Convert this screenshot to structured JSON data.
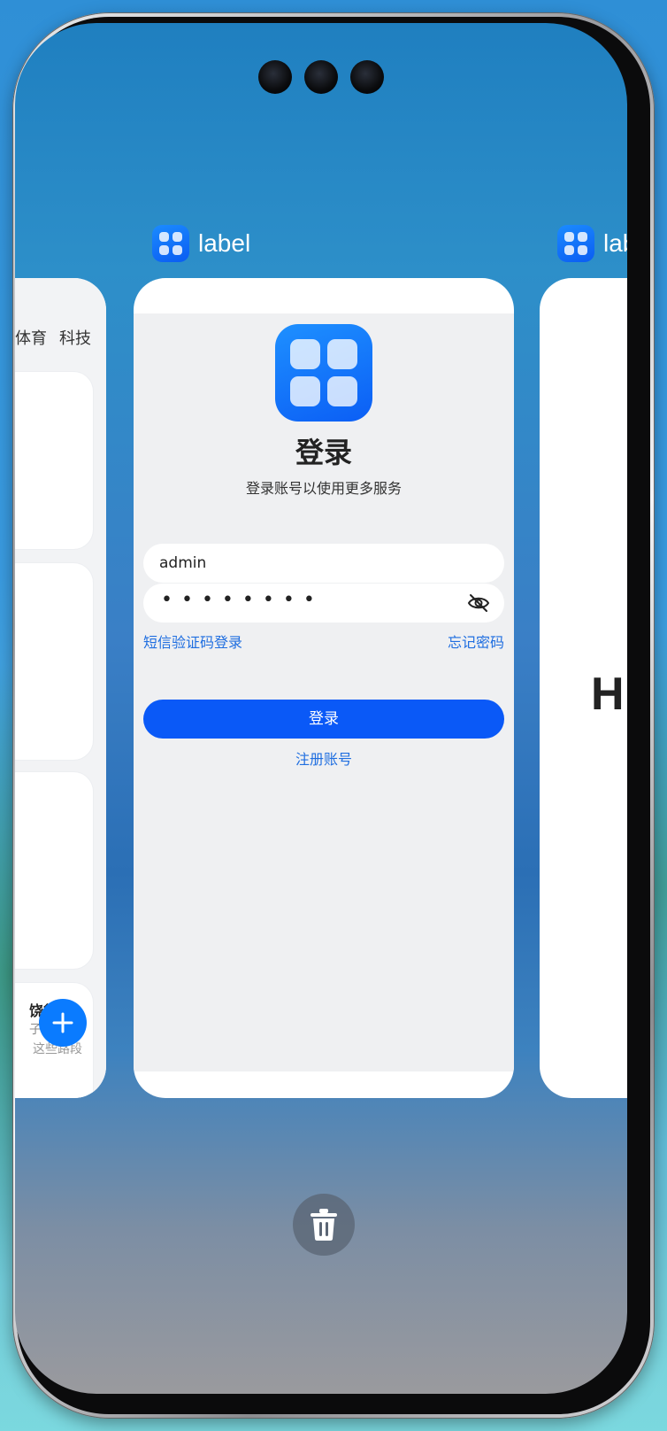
{
  "center_app": {
    "label": "label",
    "login": {
      "title": "登录",
      "subtitle": "登录账号以使用更多服务",
      "username_value": "admin",
      "password_dots": "••••••••",
      "sms_login_link": "短信验证码登录",
      "forgot_password_link": "忘记密码",
      "login_button": "登录",
      "register_link": "注册账号"
    }
  },
  "right_app": {
    "label": "label",
    "letter": "H"
  },
  "left_app": {
    "tabs": [
      "体育",
      "科技"
    ],
    "tile4_title": "饶行",
    "tile4_line2": "子弃",
    "tile4_line3": "这些路段"
  },
  "icons": {
    "fab": "plus-icon",
    "trash": "trash-icon",
    "password_toggle": "eye-off-icon"
  },
  "colors": {
    "accent": "#0a59f7",
    "link": "#1f6ee0",
    "fab": "#0a7bff"
  }
}
